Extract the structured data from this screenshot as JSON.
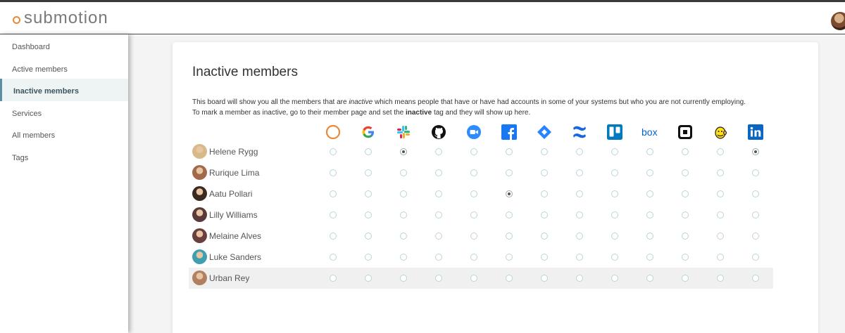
{
  "app": {
    "name": "submotion"
  },
  "sidebar": {
    "items": [
      {
        "label": "Dashboard",
        "active": false
      },
      {
        "label": "Active members",
        "active": false
      },
      {
        "label": "Inactive members",
        "active": true
      },
      {
        "label": "Services",
        "active": false
      },
      {
        "label": "All members",
        "active": false
      },
      {
        "label": "Tags",
        "active": false
      }
    ]
  },
  "page": {
    "title": "Inactive members",
    "description": {
      "line1_before": "This board will show you all the members that are ",
      "line1_em": "inactive",
      "line1_after": " which means people that have or have had accounts in some of your systems but who you are not currently employing.",
      "line2_before": "To mark a member as inactive, go to their member page and set the ",
      "line2_bold": "inactive",
      "line2_after": " tag and they will show up here."
    }
  },
  "services": [
    {
      "icon": "submotion-circle-icon",
      "color": "#e8893a"
    },
    {
      "icon": "google-icon",
      "color": "#4285f4"
    },
    {
      "icon": "slack-icon",
      "color": "#36c5f0"
    },
    {
      "icon": "github-icon",
      "color": "#111111"
    },
    {
      "icon": "zoom-icon",
      "color": "#2d8cff"
    },
    {
      "icon": "facebook-icon",
      "color": "#1877f2"
    },
    {
      "icon": "jira-icon",
      "color": "#2684ff"
    },
    {
      "icon": "confluence-icon",
      "color": "#1868db"
    },
    {
      "icon": "trello-icon",
      "color": "#0079bf"
    },
    {
      "icon": "box-icon",
      "color": "#0061d5"
    },
    {
      "icon": "square-icon",
      "color": "#111111"
    },
    {
      "icon": "mailchimp-icon",
      "color": "#241c15"
    },
    {
      "icon": "linkedin-icon",
      "color": "#0a66c2"
    }
  ],
  "members": [
    {
      "name": "Helene Rygg",
      "avatar_color": "#d8b98a",
      "accounts": [
        0,
        0,
        1,
        0,
        0,
        0,
        0,
        0,
        0,
        0,
        0,
        0,
        1
      ]
    },
    {
      "name": "Rurique Lima",
      "avatar_color": "#a36a4a",
      "accounts": [
        0,
        0,
        0,
        0,
        0,
        0,
        0,
        0,
        0,
        0,
        0,
        0,
        0
      ]
    },
    {
      "name": "Aatu Pollari",
      "avatar_color": "#3b2a22",
      "accounts": [
        0,
        0,
        0,
        0,
        0,
        1,
        0,
        0,
        0,
        0,
        0,
        0,
        0
      ]
    },
    {
      "name": "Lilly Williams",
      "avatar_color": "#5a3a3a",
      "accounts": [
        0,
        0,
        0,
        0,
        0,
        0,
        0,
        0,
        0,
        0,
        0,
        0,
        0
      ]
    },
    {
      "name": "Melaine Alves",
      "avatar_color": "#6b3f3f",
      "accounts": [
        0,
        0,
        0,
        0,
        0,
        0,
        0,
        0,
        0,
        0,
        0,
        0,
        0
      ]
    },
    {
      "name": "Luke Sanders",
      "avatar_color": "#3f9fb0",
      "accounts": [
        0,
        0,
        0,
        0,
        0,
        0,
        0,
        0,
        0,
        0,
        0,
        0,
        0
      ]
    },
    {
      "name": "Urban Rey",
      "avatar_color": "#b08060",
      "accounts": [
        0,
        0,
        0,
        0,
        0,
        0,
        0,
        0,
        0,
        0,
        0,
        0,
        0
      ]
    }
  ],
  "colors": {
    "accent": "#5b8fa0",
    "brand": "#e8893a",
    "radio_border": "#b9d6d8"
  }
}
